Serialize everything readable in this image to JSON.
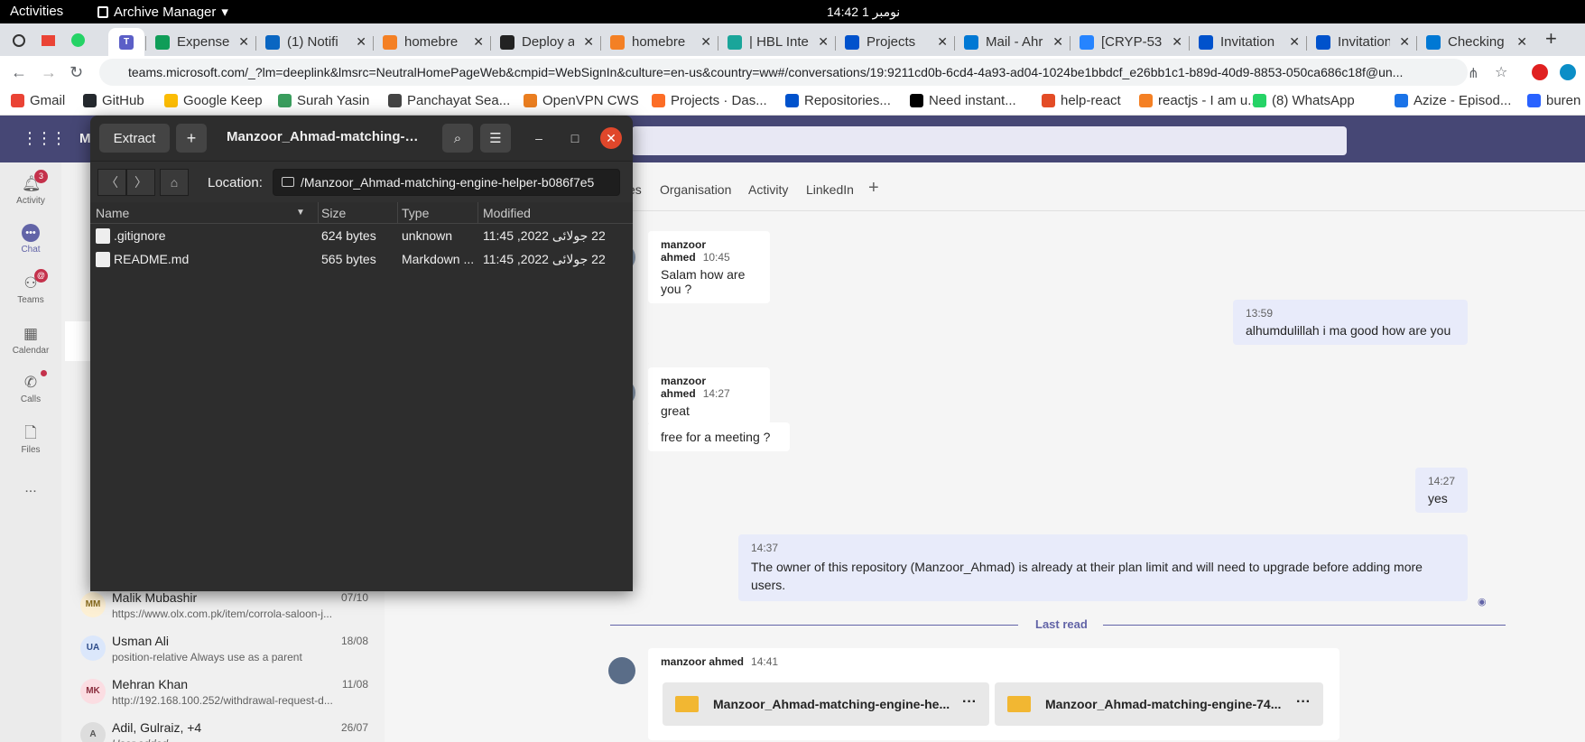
{
  "system_bar": {
    "activities": "Activities",
    "app": "Archive Manager",
    "clock": "14:42  نومبر 1"
  },
  "browser": {
    "tabs": [
      {
        "label": "Expenses"
      },
      {
        "label": "(1) Notifi"
      },
      {
        "label": "homebre"
      },
      {
        "label": "Deploy a"
      },
      {
        "label": "homebre"
      },
      {
        "label": "| HBL Inte"
      },
      {
        "label": "Projects"
      },
      {
        "label": "Mail - Ahr"
      },
      {
        "label": "[CRYP-53"
      },
      {
        "label": "Invitation"
      },
      {
        "label": "Invitation"
      },
      {
        "label": "Checking"
      }
    ],
    "url": "teams.microsoft.com/_?lm=deeplink&lmsrc=NeutralHomePageWeb&cmpid=WebSignIn&culture=en-us&country=ww#/conversations/19:9211cd0b-6cd4-4a93-ad04-1024be1bbdcf_e26bb1c1-b89d-40d9-8853-050ca686c18f@un...",
    "bookmarks": [
      {
        "label": "Gmail",
        "color": "#ea4335"
      },
      {
        "label": "GitHub",
        "color": "#24292e"
      },
      {
        "label": "Google Keep",
        "color": "#fbbc04"
      },
      {
        "label": "Surah Yasin",
        "color": "#3a9d5d"
      },
      {
        "label": "Panchayat Sea...",
        "color": "#444444"
      },
      {
        "label": "OpenVPN CWS",
        "color": "#ea7e20"
      },
      {
        "label": "Projects · Das...",
        "color": "#fc6d26"
      },
      {
        "label": "Repositories...",
        "color": "#0052cc"
      },
      {
        "label": "Need instant...",
        "color": "#000000"
      },
      {
        "label": "help-react",
        "color": "#e34c26"
      },
      {
        "label": "reactjs - I am u...",
        "color": "#f48024"
      },
      {
        "label": "(8) WhatsApp",
        "color": "#25d366"
      },
      {
        "label": "Azize - Episod...",
        "color": "#1a73e8"
      },
      {
        "label": "buren",
        "color": "#2962ff"
      }
    ]
  },
  "teams": {
    "header_letter": "M",
    "rail": [
      {
        "label": "Activity",
        "badge": "3"
      },
      {
        "label": "Chat"
      },
      {
        "label": "Teams",
        "badge": "@"
      },
      {
        "label": "Calendar"
      },
      {
        "label": "Calls"
      },
      {
        "label": "Files"
      },
      {
        "label": "..."
      }
    ],
    "chats": [
      {
        "initials": "MM",
        "name": "Malik Mubashir",
        "date": "07/10",
        "preview": "https://www.olx.com.pk/item/corrola-saloon-j..."
      },
      {
        "initials": "UA",
        "name": "Usman Ali",
        "date": "18/08",
        "preview": "position-relative Always use as a parent"
      },
      {
        "initials": "MK",
        "name": "Mehran Khan",
        "date": "11/08",
        "preview": "http://192.168.100.252/withdrawal-request-d..."
      },
      {
        "initials": "A",
        "name": "Adil, Gulraiz, +4",
        "date": "26/07",
        "preview": "User added"
      }
    ],
    "conv_tabs": [
      "es",
      "Organisation",
      "Activity",
      "LinkedIn",
      "+"
    ],
    "messages": [
      {
        "sender": "manzoor ahmed",
        "time": "10:45",
        "text": "Salam how are you ?"
      },
      {
        "time": "13:59",
        "text": "alhumdulillah i ma good how are you"
      },
      {
        "sender": "manzoor ahmed",
        "time": "14:27",
        "text": "great"
      },
      {
        "text": "free for a meeting ?"
      },
      {
        "time": "14:27",
        "text": "yes"
      },
      {
        "time": "14:37",
        "text": "The owner of this repository (Manzoor_Ahmad) is already at their plan limit and will need to upgrade before adding more users."
      },
      {
        "sender": "manzoor ahmed",
        "time": "14:41"
      }
    ],
    "last_read": "Last read",
    "attachments": [
      "Manzoor_Ahmad-matching-engine-he...",
      "Manzoor_Ahmad-matching-engine-74..."
    ]
  },
  "archive": {
    "extract_label": "Extract",
    "title": "Manzoor_Ahmad-matching-e...",
    "location_label": "Location:",
    "location": "/Manzoor_Ahmad-matching-engine-helper-b086f7e5",
    "columns": [
      "Name",
      "Size",
      "Type",
      "Modified"
    ],
    "files": [
      {
        "name": ".gitignore",
        "size": "624 bytes",
        "type": "unknown",
        "modified": "22 جولائی 2022, 11:45"
      },
      {
        "name": "README.md",
        "size": "565 bytes",
        "type": "Markdown ...",
        "modified": "22 جولائی 2022, 11:45"
      }
    ]
  }
}
